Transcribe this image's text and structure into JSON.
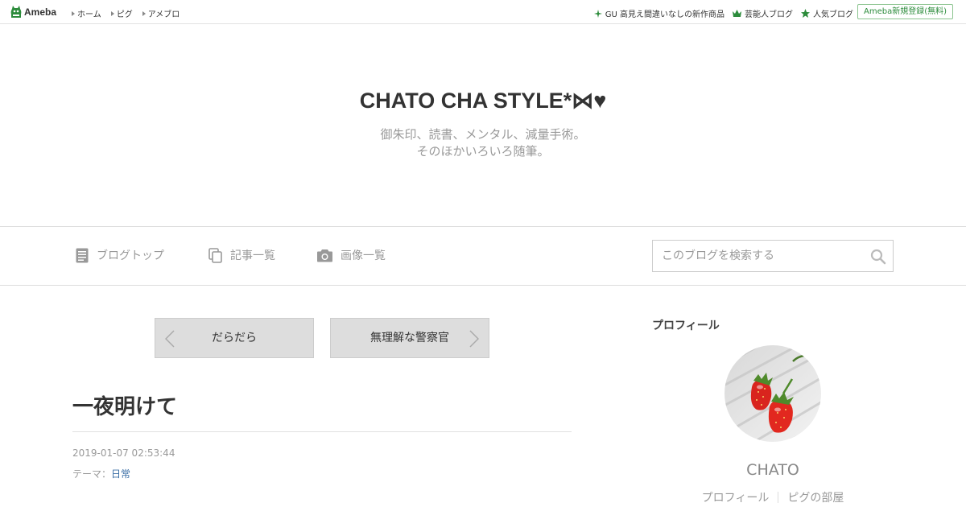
{
  "topbar": {
    "logo_text": "Ameba",
    "nav": [
      "ホーム",
      "ピグ",
      "アメブロ"
    ],
    "right_links": [
      {
        "icon": "sparkle-icon",
        "label": "GU 高見え間違いなしの新作商品"
      },
      {
        "icon": "crown-icon",
        "label": "芸能人ブログ"
      },
      {
        "icon": "star-icon",
        "label": "人気ブログ"
      }
    ],
    "register_label": "Ameba新規登録(無料)",
    "accent_color": "#2d8c3c"
  },
  "header": {
    "title": "CHATO CHA STYLE*⋈♥",
    "description_line1": "御朱印、読書、メンタル、減量手術。",
    "description_line2": "そのほかいろいろ随筆。"
  },
  "blognav": {
    "items": [
      {
        "icon": "document-icon",
        "label": "ブログトップ"
      },
      {
        "icon": "copy-icon",
        "label": "記事一覧"
      },
      {
        "icon": "camera-icon",
        "label": "画像一覧"
      }
    ],
    "search_placeholder": "このブログを検索する"
  },
  "pager": {
    "prev_label": "だらだら",
    "next_label": "無理解な警察官"
  },
  "entry": {
    "title": "一夜明けて",
    "date": "2019-01-07 02:53:44",
    "theme_prefix": "テーマ：",
    "theme": "日常"
  },
  "sidebar": {
    "heading": "プロフィール",
    "name": "CHATO",
    "links": [
      "プロフィール",
      "ピグの部屋"
    ]
  }
}
